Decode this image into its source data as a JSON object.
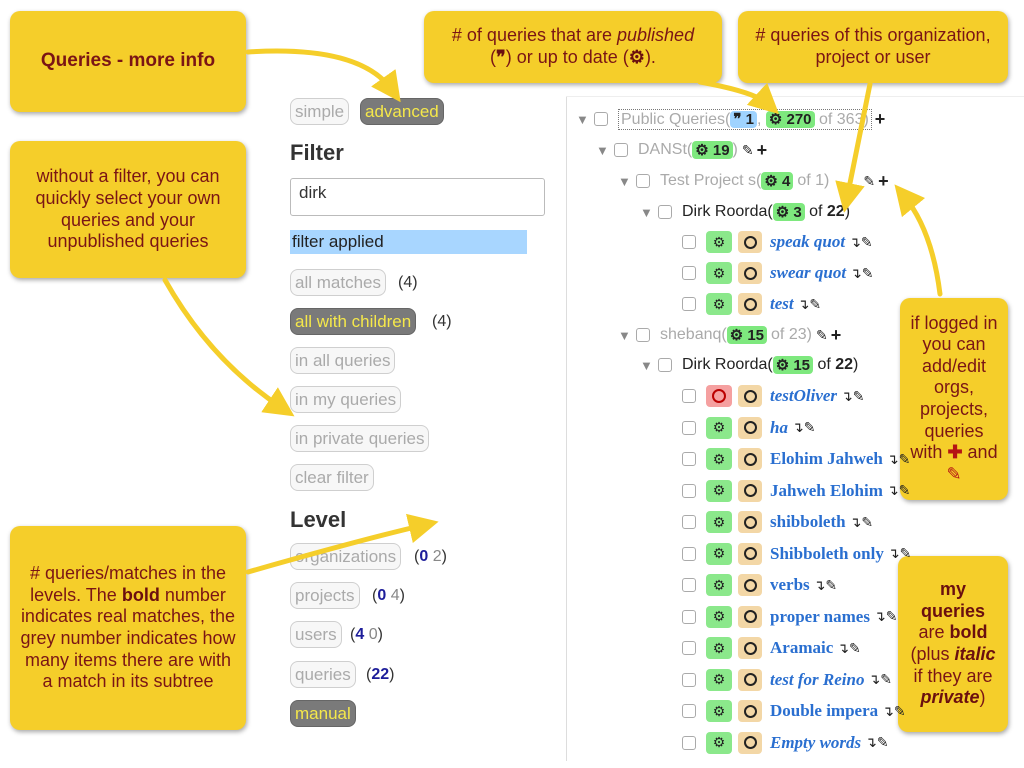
{
  "callouts": {
    "more_info": "Queries - more info",
    "published": {
      "prefix": "# of queries that are ",
      "published": "published",
      "mid": " or up to date (",
      "suffix": ")."
    },
    "org_count": "# queries of this organization, project or user",
    "no_filter": "without a filter, you can quickly select your own queries and your unpublished queries",
    "logged_in": {
      "text": "if logged in you can add/edit orgs, projects, queries with",
      "and": "and"
    },
    "levels": {
      "pre": "# queries/matches in the levels. The ",
      "bold": "bold",
      "post": " number indicates real matches, the grey number indicates how many items there are with a match in its subtree"
    },
    "my_queries": {
      "my": "my",
      "queries": "queries",
      "are": "are ",
      "bold": "bold",
      "plus": "(plus ",
      "italic": "italic",
      "if": "if they are ",
      "private": "private",
      "close": ")"
    }
  },
  "mode": {
    "simple": "simple",
    "advanced": "advanced"
  },
  "filter": {
    "heading": "Filter",
    "value": "dirk",
    "applied": "filter applied",
    "buttons": [
      {
        "label": "all matches",
        "count": "(4)"
      },
      {
        "label": "all with children",
        "count": "(4)"
      },
      {
        "label": "in all queries"
      },
      {
        "label": "in my queries"
      },
      {
        "label": "in private queries"
      },
      {
        "label": "clear filter"
      }
    ]
  },
  "level": {
    "heading": "Level",
    "items": [
      {
        "label": "organizations",
        "bold": "0",
        "grey": "2"
      },
      {
        "label": "projects",
        "bold": "0",
        "grey": "4"
      },
      {
        "label": "users",
        "bold": "4",
        "grey": "0"
      },
      {
        "label": "queries",
        "bold": "22"
      },
      {
        "label": "manual"
      }
    ]
  },
  "tree": {
    "root": {
      "label": "Public Queries",
      "published": "1",
      "uptodate": "270",
      "of": "of",
      "total": "363"
    },
    "org1": {
      "label": "DANSt",
      "uptodate": "19"
    },
    "proj1": {
      "label": "Test Project s",
      "uptodate": "4",
      "of": "of",
      "total": "1"
    },
    "user1": {
      "label": "Dirk Roorda",
      "uptodate": "3",
      "of": "of",
      "total": "22"
    },
    "user1_queries": [
      "speak quot",
      "swear quot",
      "test"
    ],
    "org2": {
      "label": "shebanq",
      "uptodate": "15",
      "of": "of",
      "total": "23"
    },
    "user2": {
      "label": "Dirk Roorda",
      "uptodate": "15",
      "of": "of",
      "total": "22"
    },
    "user2_queries": [
      {
        "name": "testOliver",
        "italic": true,
        "status": "red"
      },
      {
        "name": "ha",
        "italic": true
      },
      {
        "name": "Elohim Jahweh",
        "italic": false
      },
      {
        "name": "Jahweh Elohim",
        "italic": false
      },
      {
        "name": "shibboleth",
        "italic": false
      },
      {
        "name": "Shibboleth only",
        "italic": false
      },
      {
        "name": "verbs",
        "italic": false
      },
      {
        "name": "proper names",
        "italic": false
      },
      {
        "name": "Aramaic",
        "italic": false
      },
      {
        "name": "test for Reino",
        "italic": true
      },
      {
        "name": "Double impera",
        "italic": false
      },
      {
        "name": "Empty words",
        "italic": true
      }
    ]
  },
  "colors": {
    "callout": "#f5ce2a",
    "callout_text": "#7a1515",
    "active_btn": "#7a7a7a",
    "applied": "#a8d6ff",
    "green_badge": "#7ee87e"
  }
}
